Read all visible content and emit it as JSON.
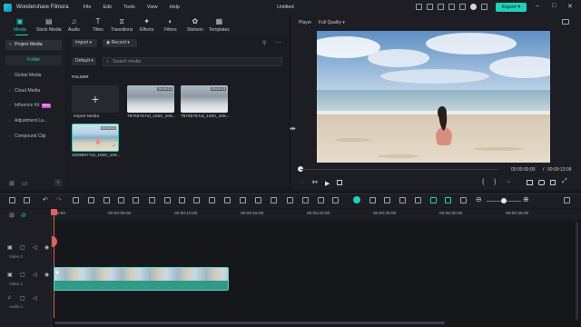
{
  "app": {
    "name": "Wondershare Filmora",
    "doc_title": "Untitled"
  },
  "menu": [
    "File",
    "Edit",
    "Tools",
    "View",
    "Help"
  ],
  "export_label": "Export",
  "tabs": [
    {
      "label": "Media",
      "icon": "media-icon"
    },
    {
      "label": "Stock Media",
      "icon": "stock-media-icon"
    },
    {
      "label": "Audio",
      "icon": "music-note-icon"
    },
    {
      "label": "Titles",
      "icon": "text-t-icon"
    },
    {
      "label": "Transitions",
      "icon": "transitions-icon"
    },
    {
      "label": "Effects",
      "icon": "effects-icon"
    },
    {
      "label": "Filters",
      "icon": "filters-icon"
    },
    {
      "label": "Stickers",
      "icon": "stickers-icon"
    },
    {
      "label": "Templates",
      "icon": "templates-icon"
    }
  ],
  "sidebar": {
    "items": [
      {
        "label": "Project Media"
      },
      {
        "label": "Folder"
      },
      {
        "label": "Global Media"
      },
      {
        "label": "Cloud Media"
      },
      {
        "label": "Influence Kit",
        "badge": "NEW"
      },
      {
        "label": "Adjustment La..."
      },
      {
        "label": "Compound Clip"
      }
    ]
  },
  "media": {
    "import_label": "Import",
    "record_label": "Record",
    "sort_label": "Default",
    "search_placeholder": "Search media",
    "section_label": "FOLDER",
    "import_tile_label": "Import Media",
    "items": [
      {
        "name": "7875576-hd_1920_108...",
        "duration": "00:00:13"
      },
      {
        "name": "7875576-hd_1920_108...",
        "duration": "00:00:13"
      },
      {
        "name": "1093667-hd_1920_108...",
        "duration": "00:00:13"
      }
    ]
  },
  "player": {
    "label": "Player",
    "quality": "Full Quality",
    "current_time": "00:00:00:00",
    "total_time": "00:00:13:09"
  },
  "timeline": {
    "ruler": [
      "00:00",
      "00:00:05:00",
      "00:00:10:00",
      "00:00:15:00",
      "00:00:20:00",
      "00:00:25:00",
      "00:00:30:00",
      "00:00:35:00"
    ],
    "tracks": [
      {
        "label": "Video 2"
      },
      {
        "label": "Video 1"
      },
      {
        "label": "Audio 1"
      }
    ]
  },
  "colors": {
    "accent": "#1fd1b8",
    "bg": "#16181d",
    "panel": "#1c1e24"
  }
}
